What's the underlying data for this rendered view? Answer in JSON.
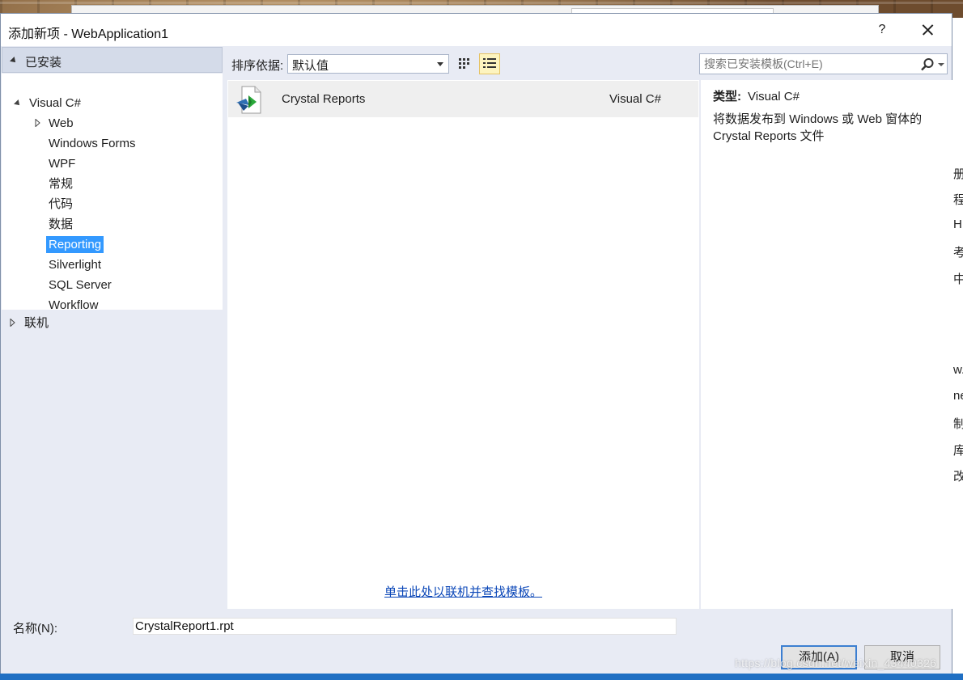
{
  "dialog": {
    "title": "添加新项 - WebApplication1",
    "help_label": "?"
  },
  "left_panel": {
    "installed_label": "已安装",
    "tree": {
      "root_label": "Visual C#",
      "items": [
        {
          "label": "Web",
          "expandable": true
        },
        {
          "label": "Windows Forms"
        },
        {
          "label": "WPF"
        },
        {
          "label": "常规"
        },
        {
          "label": "代码"
        },
        {
          "label": "数据"
        },
        {
          "label": "Reporting",
          "selected": true
        },
        {
          "label": "Silverlight"
        },
        {
          "label": "SQL Server"
        },
        {
          "label": "Workflow"
        }
      ]
    },
    "online_label": "联机"
  },
  "toolbar": {
    "sort_label": "排序依据:",
    "sort_value": "默认值",
    "search_placeholder": "搜索已安装模板(Ctrl+E)"
  },
  "templates": [
    {
      "name": "Crystal Reports",
      "type": "Visual C#"
    }
  ],
  "online_link": "单击此处以联机并查找模板。",
  "details": {
    "type_label": "类型:",
    "type_value": "Visual C#",
    "description": "将数据发布到 Windows 或 Web 窗体的 Crystal Reports 文件"
  },
  "name_field": {
    "label": "名称(N):",
    "value": "CrystalReport1.rpt"
  },
  "buttons": {
    "add": "添加(A)",
    "cancel": "取消"
  },
  "background": {
    "right_strip_glyphs": [
      "册",
      "程",
      "H",
      "考",
      "中",
      "w.c",
      "ne",
      "制",
      "库",
      "改"
    ],
    "watermark": "https://blog.csdn.net/weixin_43440326"
  },
  "colors": {
    "selection": "#3399ff",
    "link": "#0b47b8",
    "dialog_bg": "#e8ebf4"
  }
}
